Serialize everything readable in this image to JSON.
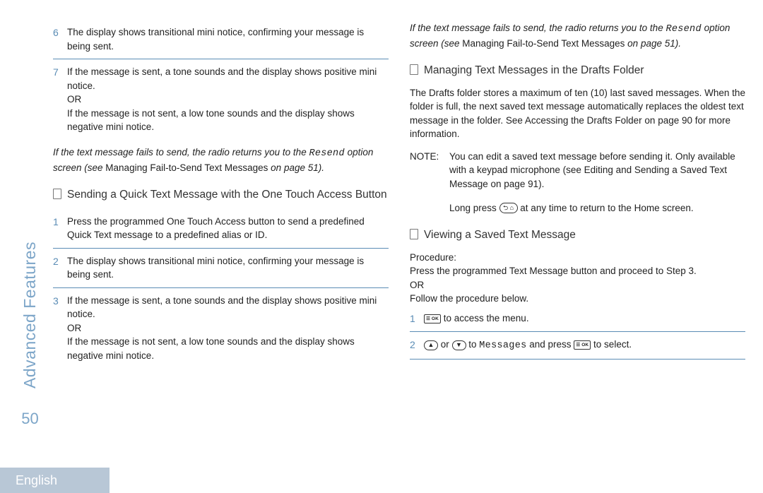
{
  "sidebar": {
    "title": "Advanced Features",
    "page_number": "50"
  },
  "footer": {
    "language": "English"
  },
  "left": {
    "step6": "The display shows transitional mini notice, confirming your message is being sent.",
    "step7a": "If the message is sent, a tone sounds and the display shows positive mini notice.",
    "or": "OR",
    "step7b": "If the message is not sent, a low tone sounds and the display shows negative mini notice.",
    "fail_note_a": "If the text message fails to send, the radio returns you to the ",
    "resend": "Resend",
    "fail_note_b": " option screen (see ",
    "fail_note_c": "Managing Fail-to-Send Text Messages",
    "fail_note_d": "  on page 51).",
    "heading": "Sending a Quick Text Message with the One Touch Access Button",
    "qt_step1": "Press the programmed One Touch Access   button to send a predefined Quick Text message to a predefined alias or ID.",
    "qt_step2": "The display shows transitional mini notice, confirming your message is being sent.",
    "qt_step3a": "If the message is sent, a tone sounds and the display shows positive mini notice.",
    "qt_step3b": "If the message is not sent, a low tone sounds and the display shows negative mini notice."
  },
  "right": {
    "fail_note_a": "If the text message fails to send, the radio returns you to the ",
    "resend": "Resend",
    "fail_note_b": " option screen (see ",
    "fail_note_c": "Managing Fail-to-Send Text Messages",
    "fail_note_d": "  on page 51).",
    "drafts_heading": "Managing Text Messages in the Drafts Folder",
    "drafts_body": "The Drafts folder stores a maximum of ten (10) last saved messages. When the folder is full, the next saved text message automatically replaces the oldest text message in the folder. See Accessing the Drafts Folder    on page 90 for more information.",
    "note_label": "NOTE:",
    "note_body1": "You can edit a saved text message before sending it. Only available with a keypad microphone (see Editing and Sending a Saved Text Message    on page 91).",
    "note_body2a": "Long press ",
    "note_body2b": " at any time to return to the Home screen.",
    "view_heading": "Viewing a Saved Text Message",
    "procedure": "Procedure:",
    "proc_line1": "Press the programmed Text Message  button and proceed to Step 3.",
    "proc_or": "OR",
    "proc_line2": "Follow the procedure below.",
    "vstep1": " to access the menu.",
    "vstep2_or": " or ",
    "vstep2_to": " to ",
    "vstep2_msgs": "Messages",
    "vstep2_press": " and press ",
    "vstep2_select": " to select."
  },
  "nums": {
    "n6": "6",
    "n7": "7",
    "n1": "1",
    "n2": "2",
    "n3": "3"
  },
  "icons": {
    "home": "⮌ ⌂",
    "menu": "☰ OK",
    "up": "▲",
    "down": "▼"
  }
}
